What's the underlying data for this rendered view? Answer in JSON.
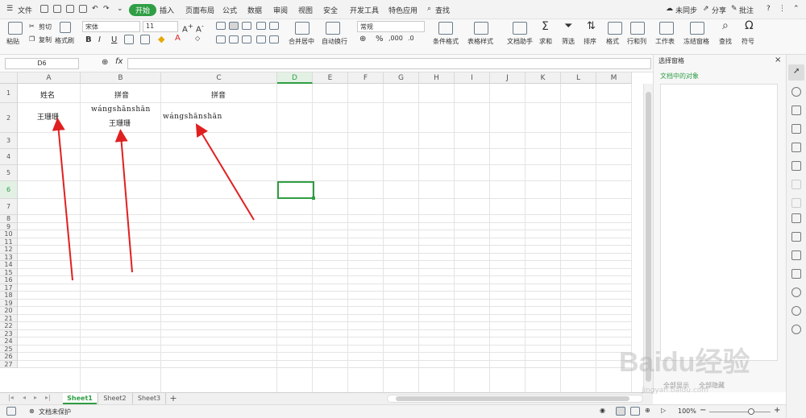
{
  "menubar": {
    "file": "文件",
    "tabs": [
      "开始",
      "插入",
      "页面布局",
      "公式",
      "数据",
      "审阅",
      "视图",
      "安全",
      "开发工具",
      "特色应用"
    ],
    "search": "查找",
    "unsync": "未同步",
    "share": "分享",
    "annotate": "批注"
  },
  "ribbon": {
    "paste": "粘贴",
    "cut": "剪切",
    "copy": "复制",
    "format_painter": "格式刷",
    "font_name": "宋体",
    "font_size": "11",
    "bold": "B",
    "italic": "I",
    "underline": "U",
    "merge_center": "合并居中",
    "wrap": "自动换行",
    "number_format": "常规",
    "percent": "%",
    "cond_format": "条件格式",
    "table_style": "表格样式",
    "doc_assist": "文档助手",
    "sum": "求和",
    "filter": "筛选",
    "sort": "排序",
    "format": "格式",
    "rowcol": "行和列",
    "worksheet": "工作表",
    "freeze": "冻结窗格",
    "find": "查找",
    "symbol": "符号"
  },
  "formula": {
    "name_box": "D6",
    "fx": "fx"
  },
  "columns": [
    "A",
    "B",
    "C",
    "D",
    "E",
    "F",
    "G",
    "H",
    "I",
    "J",
    "K",
    "L",
    "M"
  ],
  "rows": [
    "1",
    "2",
    "3",
    "4",
    "5",
    "6",
    "7",
    "8",
    "9",
    "10",
    "11",
    "12",
    "13",
    "14",
    "15",
    "16",
    "17",
    "18",
    "19",
    "20",
    "21",
    "22",
    "23",
    "24",
    "25",
    "26",
    "27"
  ],
  "cells": {
    "a1": "姓名",
    "b1": "拼音",
    "c1": "拼音",
    "a2": "王珊珊",
    "b2_pinyin": "wángshānshān",
    "b2_name": "王珊珊",
    "c2": "wángshānshān"
  },
  "panel": {
    "title": "选择窗格",
    "section": "文档中的对象",
    "show_all": "全部显示",
    "hide_all": "全部隐藏"
  },
  "sheets": [
    "Sheet1",
    "Sheet2",
    "Sheet3"
  ],
  "add_sheet": "+",
  "status": {
    "protect": "文档未保护",
    "zoom": "100%"
  },
  "watermark": "Baidu经验",
  "watermark_url": "jingyan.baidu.com",
  "colors": {
    "accent": "#2f9e44",
    "arrow": "#e02020"
  }
}
